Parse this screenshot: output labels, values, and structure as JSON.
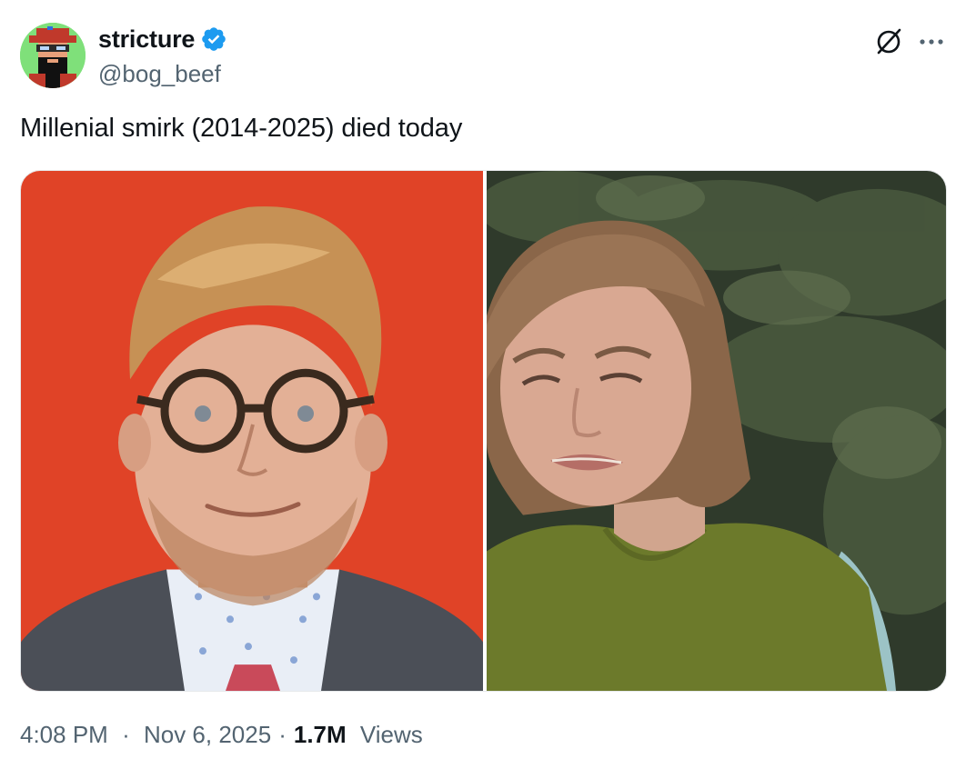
{
  "tweet": {
    "author": {
      "display_name": "stricture",
      "handle": "@bog_beef",
      "verified": true,
      "badge_color": "#1d9bf0"
    },
    "text": "Millenial smirk (2014-2025) died today",
    "media": [
      {
        "kind": "photo",
        "description": "Man with glasses and styled hair smiling against a red background"
      },
      {
        "kind": "photo",
        "description": "Woman in a green sweater grimacing in front of dark foliage"
      }
    ],
    "time": "4:08 PM",
    "date": "Nov 6, 2025",
    "separator": "·",
    "views_count": "1.7M",
    "views_label": "Views"
  },
  "icons": {
    "grok": "grok-icon",
    "more": "more-icon",
    "verified": "verified-badge-icon"
  },
  "colors": {
    "text_primary": "#0f1419",
    "text_secondary": "#536471",
    "verified": "#1d9bf0"
  }
}
